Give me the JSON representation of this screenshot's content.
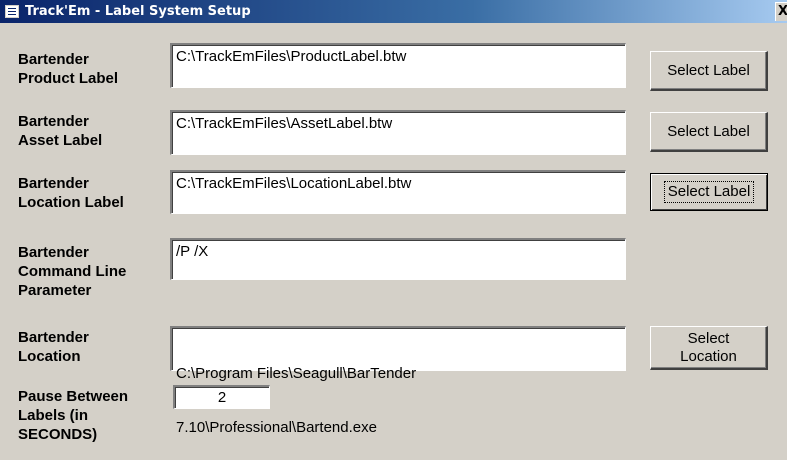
{
  "window": {
    "title": "Track'Em - Label System Setup",
    "close_glyph": "X"
  },
  "fields": {
    "product_label": {
      "label_line1": "Bartender",
      "label_line2": "Product Label",
      "value": "C:\\TrackEmFiles\\ProductLabel.btw",
      "button": "Select Label"
    },
    "asset_label": {
      "label_line1": "Bartender",
      "label_line2": "Asset Label",
      "value": "C:\\TrackEmFiles\\AssetLabel.btw",
      "button": "Select Label"
    },
    "location_label": {
      "label_line1": "Bartender",
      "label_line2": "Location Label",
      "value": "C:\\TrackEmFiles\\LocationLabel.btw",
      "button": "Select Label"
    },
    "command_line": {
      "label_line1": "Bartender",
      "label_line2": "Command Line",
      "label_line3": "Parameter",
      "value": "/P /X"
    },
    "bartender_location": {
      "label_line1": "Bartender",
      "label_line2": "Location",
      "value_line1": "C:\\Program Files\\Seagull\\BarTender",
      "value_line2": "7.10\\Professional\\Bartend.exe",
      "button_line1": "Select",
      "button_line2": "Location"
    },
    "pause": {
      "label_line1": "Pause Between",
      "label_line2": "Labels (in",
      "label_line3": "SECONDS)",
      "value": "2"
    }
  }
}
